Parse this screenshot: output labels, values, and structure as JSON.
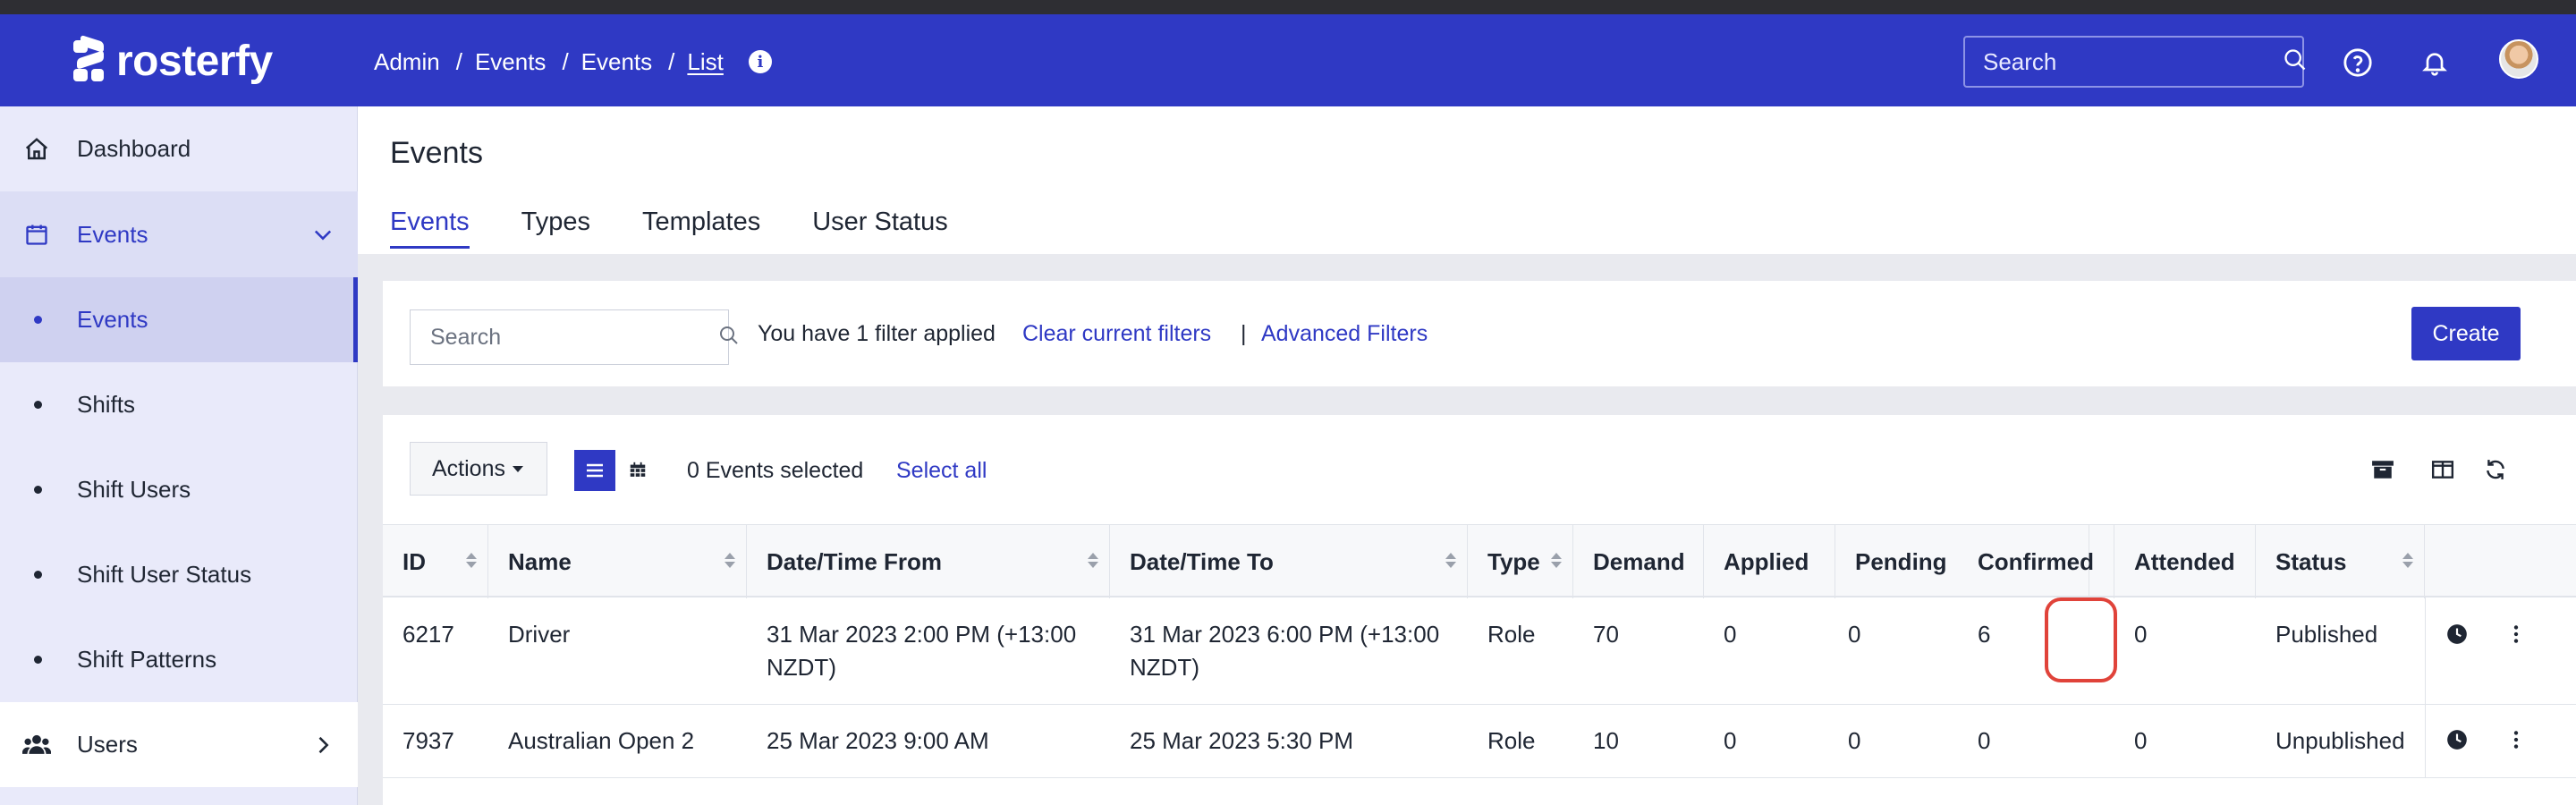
{
  "app": {
    "brand": "rosterfy"
  },
  "breadcrumb": [
    "Admin",
    "Events",
    "Events",
    "List"
  ],
  "header_search": {
    "placeholder": "Search"
  },
  "sidebar": {
    "items": [
      {
        "label": "Dashboard",
        "icon": "home-icon",
        "type": "top"
      },
      {
        "label": "Events",
        "icon": "calendar-icon",
        "type": "group",
        "expanded": true
      },
      {
        "label": "Events",
        "type": "sub",
        "active": true
      },
      {
        "label": "Shifts",
        "type": "sub"
      },
      {
        "label": "Shift Users",
        "type": "sub"
      },
      {
        "label": "Shift User Status",
        "type": "sub"
      },
      {
        "label": "Shift Patterns",
        "type": "sub"
      },
      {
        "label": "Users",
        "icon": "users-icon",
        "type": "group",
        "expanded": false
      }
    ]
  },
  "page": {
    "title": "Events",
    "tabs": [
      "Events",
      "Types",
      "Templates",
      "User Status"
    ],
    "active_tab": "Events"
  },
  "filters": {
    "search_placeholder": "Search",
    "status_text": "You have 1 filter applied",
    "clear_label": "Clear current filters",
    "separator": "|",
    "advanced_label": "Advanced Filters",
    "create_label": "Create"
  },
  "toolbar": {
    "actions_label": "Actions",
    "selected_text": "0 Events selected",
    "select_all_label": "Select all"
  },
  "table": {
    "columns": [
      "ID",
      "Name",
      "Date/Time From",
      "Date/Time To",
      "Type",
      "Demand",
      "Applied",
      "Pending",
      "Confirmed",
      "Attended",
      "Status"
    ],
    "rows": [
      {
        "id": "6217",
        "name": "Driver",
        "from_line1": "31 Mar 2023 2:00 PM (+13:00",
        "from_line2": "NZDT)",
        "to_line1": "31 Mar 2023 6:00 PM (+13:00",
        "to_line2": "NZDT)",
        "type": "Role",
        "demand": "70",
        "applied": "0",
        "pending": "0",
        "confirmed": "6",
        "attended": "0",
        "status": "Published"
      },
      {
        "id": "7937",
        "name": "Australian Open 2",
        "from_line1": "25 Mar 2023 9:00 AM",
        "from_line2": "",
        "to_line1": "25 Mar 2023 5:30 PM",
        "to_line2": "",
        "type": "Role",
        "demand": "10",
        "applied": "0",
        "pending": "0",
        "confirmed": "0",
        "attended": "0",
        "status": "Unpublished"
      }
    ]
  },
  "colors": {
    "brand": "#2f39c4",
    "sidebar_bg": "#e9eafa",
    "highlight": "#e0433a"
  }
}
